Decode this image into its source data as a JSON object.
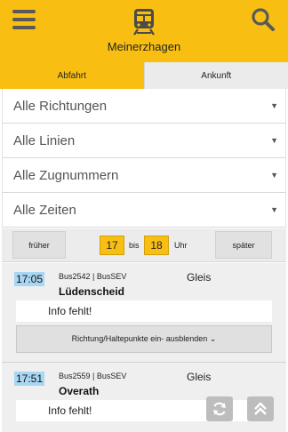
{
  "header": {
    "station": "Meinerzhagen",
    "menu_icon": "hamburger-menu-icon",
    "train_icon": "train-icon",
    "search_icon": "search-icon",
    "brand_color": "#f8bf12"
  },
  "tabs": [
    {
      "label": "Abfahrt",
      "active": true
    },
    {
      "label": "Ankunft",
      "active": false
    }
  ],
  "filters": [
    {
      "label": "Alle Richtungen"
    },
    {
      "label": "Alle Linien"
    },
    {
      "label": "Alle Zugnummern"
    },
    {
      "label": "Alle Zeiten"
    }
  ],
  "timebar": {
    "earlier_label": "früher",
    "from_hour": "17",
    "to_text": "bis",
    "to_hour": "18",
    "unit": "Uhr",
    "later_label": "später"
  },
  "departures": [
    {
      "time": "17:05",
      "train": "Bus2542 | BusSEV",
      "destination": "Lüdenscheid",
      "gleis_label": "Gleis",
      "info": "Info fehlt!",
      "toggle_label": "Richtung/Haltepunkte ein- ausblenden ⌄"
    },
    {
      "time": "17:51",
      "train": "Bus2559 | BusSEV",
      "destination": "Overath",
      "gleis_label": "Gleis",
      "info": "Info fehlt!"
    }
  ],
  "fabs": {
    "refresh_icon": "refresh-icon",
    "scroll_top_icon": "scroll-to-top-icon"
  }
}
